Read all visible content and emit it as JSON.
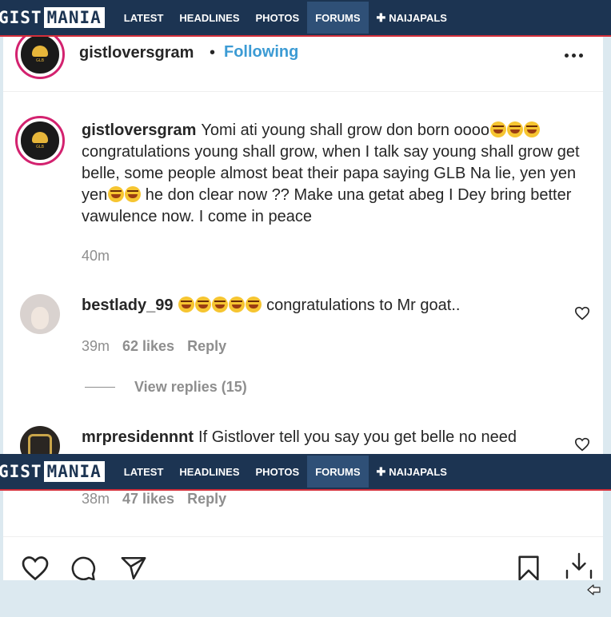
{
  "nav": {
    "logo_left": "GIST",
    "logo_right": "MANIA",
    "items": [
      {
        "label": "LATEST"
      },
      {
        "label": "HEADLINES"
      },
      {
        "label": "PHOTOS"
      },
      {
        "label": "FORUMS",
        "active": true
      },
      {
        "label": "NAIJAPALS",
        "icon": "plus-icon"
      }
    ],
    "colors": {
      "bar": "#1c3452",
      "accent_line": "#d42f3a",
      "active": "#2f5077"
    }
  },
  "post": {
    "header": {
      "username": "gistloversgram",
      "separator": "•",
      "follow_label": "Following",
      "more_icon": "more-horizontal-icon"
    },
    "caption": {
      "username": "gistloversgram",
      "text_1": "Yomi ati young shall grow don born oooo",
      "emoji_1_count": 3,
      "text_2": "congratulations young shall grow, when I talk say young shall grow get belle, some people almost beat their papa saying GLB Na lie, yen yen yen",
      "emoji_2_count": 2,
      "text_3": " he don clear now ?? Make una getat abeg I Dey bring better vawulence now. I come in peace",
      "time": "40m",
      "emoji_name": "face-with-tears-of-joy-icon"
    },
    "comments": [
      {
        "username": "bestlady_99",
        "emoji_count": 5,
        "text": "congratulations to Mr goat..",
        "time": "39m",
        "likes": "62 likes",
        "reply_label": "Reply",
        "view_replies": "View replies (15)"
      },
      {
        "username": "mrpresidennnt",
        "text": "If Gistlover tell you say you get belle no need",
        "time": "38m",
        "likes": "47 likes",
        "reply_label": "Reply"
      }
    ],
    "actions": [
      "heart-icon",
      "comment-icon",
      "share-icon",
      "bookmark-icon",
      "download-icon"
    ],
    "colors": {
      "link": "#3c9bd4",
      "text": "#262626",
      "muted": "#8e8e8e",
      "story_ring": "#d3226f"
    }
  }
}
